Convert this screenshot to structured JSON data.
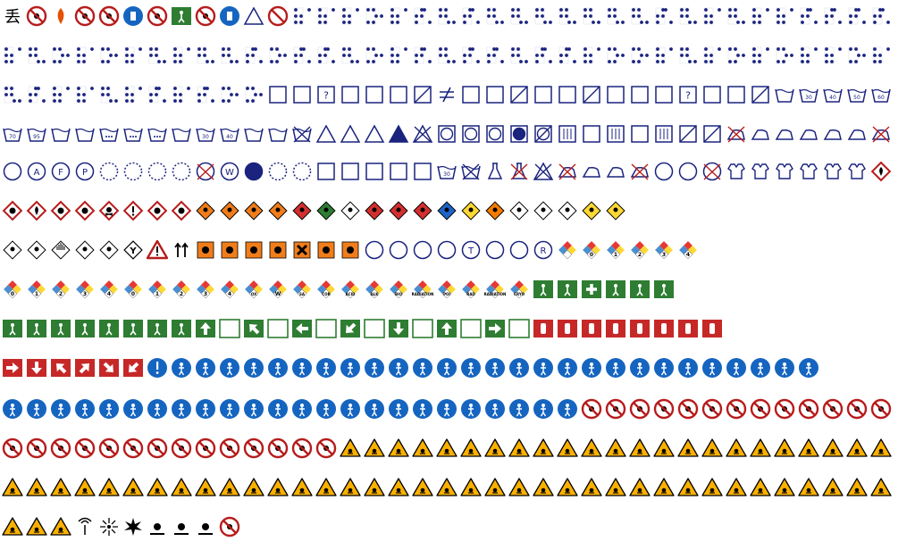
{
  "page": {
    "title": "",
    "background": "#ffffff"
  },
  "palette": {
    "navy": "#1a237e",
    "prohibition_red": "#b71c1c",
    "safe_green": "#2e7d32",
    "mandatory_blue": "#1565c0",
    "warning_yellow": "#f9b000",
    "hazmat_orange": "#f07d1a",
    "fire_red": "#c62828",
    "nfpa_blue": "#4a8fd0",
    "nfpa_red": "#e53935",
    "nfpa_yellow": "#fdd835",
    "black": "#000000"
  },
  "rows": [
    {
      "id": "row-1",
      "theme": "mixed pictograms and braille",
      "icons": [
        "chinese-character-icon",
        "no-smoking-circle-icon",
        "flame-icon",
        "no-entry-icon",
        "no-smoking-icon",
        "litter-bin-icon",
        "no-littering-icon",
        "recycle-green-icon",
        "no-littering-icon",
        "pedestrian-icon",
        "triangle-outline-icon",
        "prohibited-circle-icon",
        "braille-cell-icon",
        "braille-cell-icon",
        "braille-cell-icon",
        "braille-cell-icon",
        "braille-cell-icon",
        "braille-cell-icon",
        "braille-cell-icon",
        "braille-cell-icon",
        "braille-cell-icon",
        "braille-cell-icon",
        "braille-cell-icon",
        "braille-cell-icon",
        "braille-cell-icon",
        "braille-cell-icon",
        "braille-cell-icon",
        "braille-cell-icon",
        "braille-cell-icon",
        "braille-cell-icon",
        "braille-cell-icon",
        "braille-cell-icon",
        "braille-cell-icon",
        "braille-cell-icon",
        "braille-cell-icon",
        "braille-cell-icon",
        "braille-cell-icon",
        "braille-cell-icon"
      ]
    },
    {
      "id": "row-2",
      "theme": "braille cells",
      "icons": [
        "braille-cell-icon",
        "braille-cell-icon",
        "braille-cell-icon",
        "braille-cell-icon",
        "braille-cell-icon",
        "braille-cell-icon",
        "braille-cell-icon",
        "braille-cell-icon",
        "braille-cell-icon",
        "braille-cell-icon",
        "braille-cell-icon",
        "braille-cell-icon",
        "braille-cell-icon",
        "braille-cell-icon",
        "braille-cell-icon",
        "braille-cell-icon",
        "braille-cell-icon",
        "braille-cell-icon",
        "braille-cell-icon",
        "braille-cell-icon",
        "braille-cell-icon",
        "braille-cell-icon",
        "braille-cell-icon",
        "braille-cell-icon",
        "braille-cell-icon",
        "braille-cell-icon",
        "braille-cell-icon",
        "braille-cell-icon",
        "braille-cell-icon",
        "braille-cell-icon",
        "braille-cell-icon",
        "braille-cell-icon",
        "braille-cell-icon",
        "braille-cell-icon",
        "braille-cell-icon",
        "braille-cell-icon",
        "braille-cell-icon"
      ]
    },
    {
      "id": "row-3",
      "theme": "braille cells and washing/drying boxes",
      "icons": [
        "braille-cell-icon",
        "braille-cell-icon",
        "braille-cell-icon",
        "braille-cell-icon",
        "braille-cell-icon",
        "braille-cell-icon",
        "braille-cell-icon",
        "braille-cell-icon",
        "braille-cell-icon",
        "braille-cell-icon",
        "braille-cell-icon",
        "box-outline-icon",
        "box-flag-icon",
        "box-question-icon",
        "box-arrow-icon",
        "box-bracket-icon",
        "box-double-icon",
        "box-slash-icon",
        "not-equal-icon",
        "box-wide-icon",
        "box-circle-icon",
        "box-slash-icon",
        "box-arrow-icon",
        "box-e-icon",
        "box-slash-icon",
        "box-z-icon",
        "box-arrow-icon",
        "box-r-icon",
        "box-question-icon",
        "box-outline-icon",
        "box-outline-icon",
        "box-cross-icon",
        "wash-tub-icon",
        "wash-tub-30-icon",
        "wash-tub-40-icon",
        "wash-tub-50-icon",
        "wash-tub-60-icon"
      ]
    },
    {
      "id": "row-4",
      "theme": "laundry care symbols",
      "icons": [
        "wash-tub-70-icon",
        "wash-tub-95-icon",
        "wash-tub-icon",
        "wash-tub-icon",
        "wash-tub-dots-icon",
        "wash-tub-dots-icon",
        "wash-tub-dots-icon",
        "hand-wash-icon",
        "hand-wash-30-icon",
        "hand-wash-40-icon",
        "hand-wash-icon",
        "hand-wash-icon",
        "wash-cross-icon",
        "bleach-triangle-icon",
        "bleach-triangle-lines-icon",
        "bleach-cl-icon",
        "bleach-solid-icon",
        "bleach-cross-icon",
        "tumble-dry-icon",
        "tumble-dry-dot-icon",
        "tumble-dry-dots-icon",
        "tumble-dry-solid-icon",
        "tumble-dry-cross-icon",
        "dry-lines-icon",
        "dry-box-icon",
        "dry-box-lines-icon",
        "dry-box-icon",
        "dry-box-lines-icon",
        "dry-box-slash-icon",
        "dry-box-cross-icon",
        "iron-cross-icon",
        "iron-icon",
        "iron-icon",
        "iron-dot-icon",
        "iron-dots-icon",
        "iron-dots-icon",
        "iron-cross-icon"
      ]
    },
    {
      "id": "row-5",
      "theme": "dry-cleaning and fabric care",
      "icons": [
        "dry-clean-circle-icon",
        "dry-clean-a-icon",
        "dry-clean-f-icon",
        "dry-clean-p-icon",
        "dry-clean-dashed-icon",
        "dry-clean-dashed-icon",
        "dry-clean-dashed-icon",
        "dry-clean-dashed-icon",
        "dry-clean-cross-icon",
        "wet-clean-w-icon",
        "dry-clean-solid-icon",
        "dry-clean-dashed-icon",
        "dry-clean-dashed-icon",
        "care-label-grid-icon",
        "care-label-grid-icon",
        "care-label-grid-icon",
        "care-label-grid-icon",
        "care-label-grid-icon",
        "wash-tub-30-icon",
        "wash-cross-icon",
        "flask-icon",
        "flask-cross-icon",
        "bleach-cross-icon",
        "iron-cross-icon",
        "iron-icon",
        "iron-light-icon",
        "iron-cross-icon",
        "wave-circle-icon",
        "wave-circle-icon",
        "wave-cross-icon",
        "fabric-bow-icon",
        "fabric-bow-cross-icon",
        "garment-shirt-icon",
        "garment-shirt-icon",
        "garment-shirt-icon",
        "garment-shirt-icon",
        "flammable-diamond-icon"
      ]
    },
    {
      "id": "row-6",
      "theme": "GHS and ADR hazard diamonds",
      "icons": [
        "ghs-explosive-icon",
        "ghs-flammable-icon",
        "ghs-environment-icon",
        "ghs-oxidizer-icon",
        "ghs-toxic-icon",
        "ghs-exclamation-icon",
        "ghs-corrosive-icon",
        "ghs-health-hazard-icon",
        "adr-explosive-icon",
        "adr-1-4-icon",
        "adr-1-5-icon",
        "adr-1-6-icon",
        "adr-flammable-gas-icon",
        "adr-non-flammable-gas-icon",
        "adr-poison-gas-icon",
        "adr-flammable-liquid-icon",
        "adr-flammable-solid-icon",
        "adr-spontaneous-icon",
        "adr-dangerous-wet-icon",
        "adr-oxidizer-icon",
        "adr-organic-peroxide-icon",
        "adr-toxic-icon",
        "adr-infectious-icon",
        "adr-radioactive-i-icon",
        "adr-radioactive-ii-icon",
        "adr-radioactive-iii-icon"
      ]
    },
    {
      "id": "row-7",
      "theme": "transport and hazard markings",
      "icons": [
        "adr-corrosive-icon",
        "adr-misc-icon",
        "adr-misc-stripes-icon",
        "adr-environment-icon",
        "adr-lithium-icon",
        "cargo-y-icon",
        "warning-triangle-red-icon",
        "this-way-up-icon",
        "eu-explosive-orange-icon",
        "eu-flammable-orange-icon",
        "eu-oxidizer-orange-icon",
        "eu-toxic-orange-icon",
        "eu-harmful-orange-icon",
        "eu-corrosive-orange-icon",
        "eu-environment-orange-icon",
        "circle-slash-icon",
        "circle-flame-icon",
        "circle-flame-icon",
        "circle-skull-icon",
        "circle-t-icon",
        "circle-tank-icon",
        "circle-hand-icon",
        "circle-r-icon",
        "nfpa-diamond-icon",
        "nfpa-0-icon",
        "nfpa-1-icon",
        "nfpa-2-icon",
        "nfpa-3-icon",
        "nfpa-4-icon"
      ]
    },
    {
      "id": "row-8",
      "theme": "NFPA 704 diamonds and safe-condition signs",
      "icons": [
        "nfpa-0-icon",
        "nfpa-1-icon",
        "nfpa-2-icon",
        "nfpa-3-icon",
        "nfpa-4-icon",
        "nfpa-0-icon",
        "nfpa-1-icon",
        "nfpa-2-icon",
        "nfpa-3-icon",
        "nfpa-4-icon",
        "nfpa-ox-icon",
        "nfpa-w-icon",
        "nfpa-sa-icon",
        "nfpa-cor-icon",
        "nfpa-acid-icon",
        "nfpa-alk-icon",
        "nfpa-bio-icon",
        "nfpa-radiation-icon",
        "nfpa-poi-icon",
        "nfpa-rad-icon",
        "nfpa-radiation-icon",
        "nfpa-cryo-icon",
        "emergency-exit-green-icon",
        "emergency-exit-green-icon",
        "first-aid-cross-icon",
        "emergency-phone-icon",
        "assembly-point-icon",
        "emergency-exit-running-icon"
      ]
    },
    {
      "id": "row-9",
      "theme": "safe-condition and fire equipment signs",
      "icons": [
        "first-aid-person-icon",
        "defibrillator-icon",
        "eyewash-icon",
        "safety-shower-icon",
        "stretcher-icon",
        "emergency-exit-door-icon",
        "evacuation-chair-icon",
        "emergency-exit-window-icon",
        "arrow-up-green-icon",
        "blank-white-panel-icon",
        "arrow-up-left-green-icon",
        "blank-white-panel-icon",
        "arrow-left-green-icon",
        "blank-white-panel-icon",
        "arrow-down-left-green-icon",
        "blank-white-panel-icon",
        "arrow-down-green-icon",
        "blank-white-panel-icon",
        "arrow-up-green-icon",
        "blank-white-panel-icon",
        "arrow-right-green-icon",
        "blank-white-panel-icon",
        "fire-extinguisher-icon",
        "fire-hose-icon",
        "fire-ladder-icon",
        "fire-alarm-icon",
        "fire-phone-icon",
        "fire-equipment-icon",
        "fire-equipment-icon",
        "fire-equipment-icon"
      ]
    },
    {
      "id": "row-10",
      "theme": "fire direction arrows and mandatory signs",
      "icons": [
        "arrow-right-red-icon",
        "arrow-down-red-icon",
        "arrow-up-left-red-icon",
        "arrow-up-right-red-icon",
        "arrow-down-right-red-icon",
        "arrow-down-left-red-icon",
        "mandatory-exclamation-icon",
        "wear-gloves-icon",
        "wear-hearing-icon",
        "wear-goggles-icon",
        "earth-terminal-icon",
        "wash-hands-icon",
        "wear-mask-icon",
        "wear-boots-icon",
        "wear-gloves-icon",
        "wear-overalls-icon",
        "wear-apron-icon",
        "use-handrail-icon",
        "use-crossing-icon",
        "wear-helmet-icon",
        "wear-hivis-icon",
        "wear-face-shield-icon",
        "wear-respirator-icon",
        "walk-icon",
        "disconnect-plug-icon",
        "refer-manual-icon",
        "use-screen-icon",
        "wear-harness-icon",
        "wear-welding-mask-icon",
        "use-extinguisher-icon",
        "use-footbridge-icon",
        "lock-icon",
        "sound-horn-icon",
        "wear-cap-icon"
      ]
    },
    {
      "id": "row-11",
      "theme": "mandatory and prohibition signs",
      "icons": [
        "mandatory-lift-icon",
        "mandatory-person-icon",
        "mandatory-person-icon",
        "mandatory-lifejacket-icon",
        "mandatory-person-icon",
        "mandatory-bag-icon",
        "mandatory-person-icon",
        "mandatory-barrier-icon",
        "mandatory-barrier-icon",
        "mandatory-person-icon",
        "mandatory-person-icon",
        "mandatory-person-icon",
        "mandatory-cone-icon",
        "mandatory-sanitize-icon",
        "mandatory-bucket-icon",
        "mandatory-container-icon",
        "mandatory-child-icon",
        "mandatory-brush-icon",
        "mandatory-person-icon",
        "mandatory-walk-icon",
        "mandatory-ramp-icon",
        "mandatory-coat-icon",
        "mandatory-person-icon",
        "mandatory-person-icon",
        "no-machinery-icon",
        "no-pacemaker-icon",
        "no-entry-person-icon",
        "no-dog-icon",
        "no-metal-icon",
        "no-reaching-icon",
        "no-flame-icon",
        "no-foot-icon",
        "no-person-icon",
        "no-running-icon",
        "no-eating-icon",
        "no-climbing-icon",
        "no-telephone-icon"
      ]
    },
    {
      "id": "row-12",
      "theme": "prohibition and warning signs",
      "icons": [
        "no-dog-icon",
        "no-smoking-icon",
        "no-touching-icon",
        "no-footwear-icon",
        "no-walking-icon",
        "no-lift-icon",
        "no-sitting-icon",
        "no-mobile-icon",
        "no-camera-icon",
        "no-drinking-icon",
        "no-spray-icon",
        "no-car-icon",
        "no-wheelchair-icon",
        "no-bicycle-icon",
        "warning-explosive-icon",
        "warning-radiation-icon",
        "warning-laser-icon",
        "warning-toxic-icon",
        "warning-corrosive-icon",
        "warning-electric-icon",
        "warning-general-icon",
        "warning-forklift-icon",
        "warning-machinery-icon",
        "warning-overhead-icon",
        "warning-person-icon",
        "warning-person-icon",
        "warning-obstacle-icon",
        "warning-fall-icon",
        "warning-slippery-icon",
        "warning-electric-icon",
        "warning-cold-icon",
        "warning-hot-icon",
        "warning-magnet-icon",
        "warning-crush-icon",
        "warning-cut-icon",
        "warning-person-icon",
        "warning-person-icon"
      ]
    },
    {
      "id": "row-13",
      "theme": "warning triangles",
      "icons": [
        "warning-fire-icon",
        "warning-biohazard-icon",
        "warning-person-icon",
        "warning-light-icon",
        "warning-person-icon",
        "warning-person-icon",
        "warning-person-icon",
        "warning-person-icon",
        "warning-trip-icon",
        "warning-person-icon",
        "warning-step-icon",
        "warning-person-icon",
        "warning-roller-icon",
        "warning-drop-icon",
        "warning-person-icon",
        "warning-person-icon",
        "warning-person-icon",
        "warning-person-icon",
        "warning-person-icon",
        "warning-person-icon",
        "warning-person-icon",
        "warning-person-icon",
        "warning-person-icon",
        "warning-person-icon",
        "warning-person-icon",
        "warning-step-icon",
        "warning-person-icon",
        "warning-person-icon",
        "warning-person-icon",
        "warning-person-icon",
        "warning-person-icon",
        "warning-hand-icon",
        "warning-person-icon",
        "warning-wave-icon",
        "warning-person-icon",
        "warning-person-icon",
        "warning-person-icon"
      ]
    },
    {
      "id": "row-14",
      "theme": "remaining warning pictograms",
      "icons": [
        "warning-slope-icon",
        "warning-person-icon",
        "warning-person-icon",
        "radio-waves-icon",
        "laser-beam-icon",
        "explosion-icon",
        "flammable-pictogram-icon",
        "environment-pictogram-icon",
        "corrosive-pictogram-icon",
        "no-touch-red-icon"
      ]
    }
  ]
}
